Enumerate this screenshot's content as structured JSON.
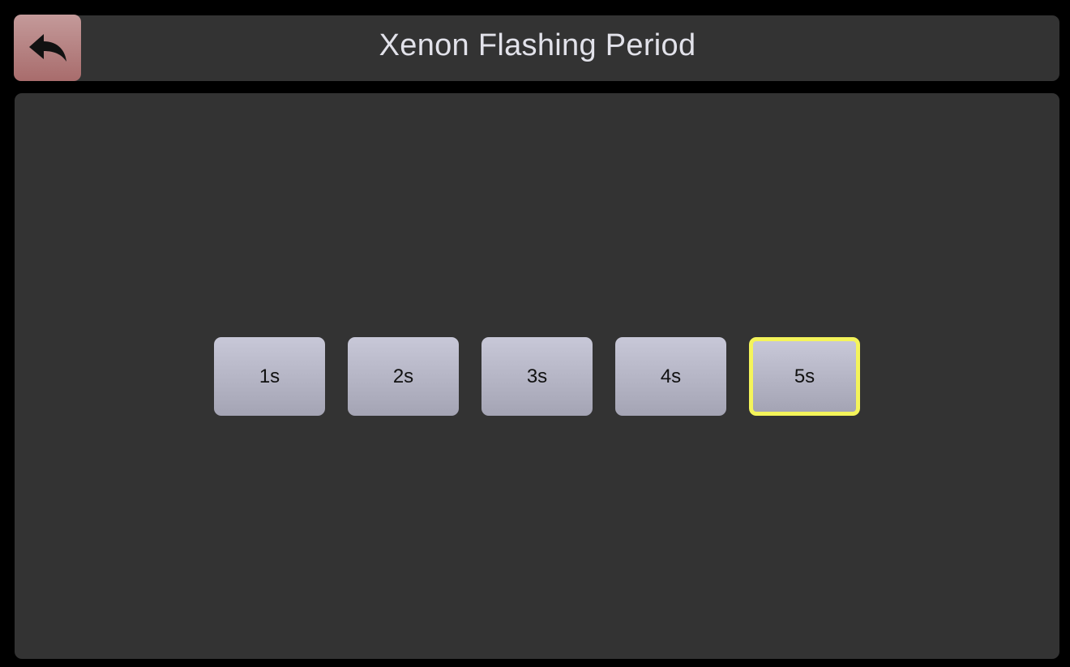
{
  "header": {
    "title": "Xenon Flashing Period",
    "back_icon": "back-arrow-icon"
  },
  "options": [
    {
      "label": "1s",
      "selected": false
    },
    {
      "label": "2s",
      "selected": false
    },
    {
      "label": "3s",
      "selected": false
    },
    {
      "label": "4s",
      "selected": false
    },
    {
      "label": "5s",
      "selected": true
    }
  ],
  "colors": {
    "background": "#000000",
    "panel": "#333333",
    "back_button": "#b07878",
    "option_button": "#b8b8c8",
    "selected_border": "#f4f45a",
    "title_text": "#e2e2ea"
  }
}
